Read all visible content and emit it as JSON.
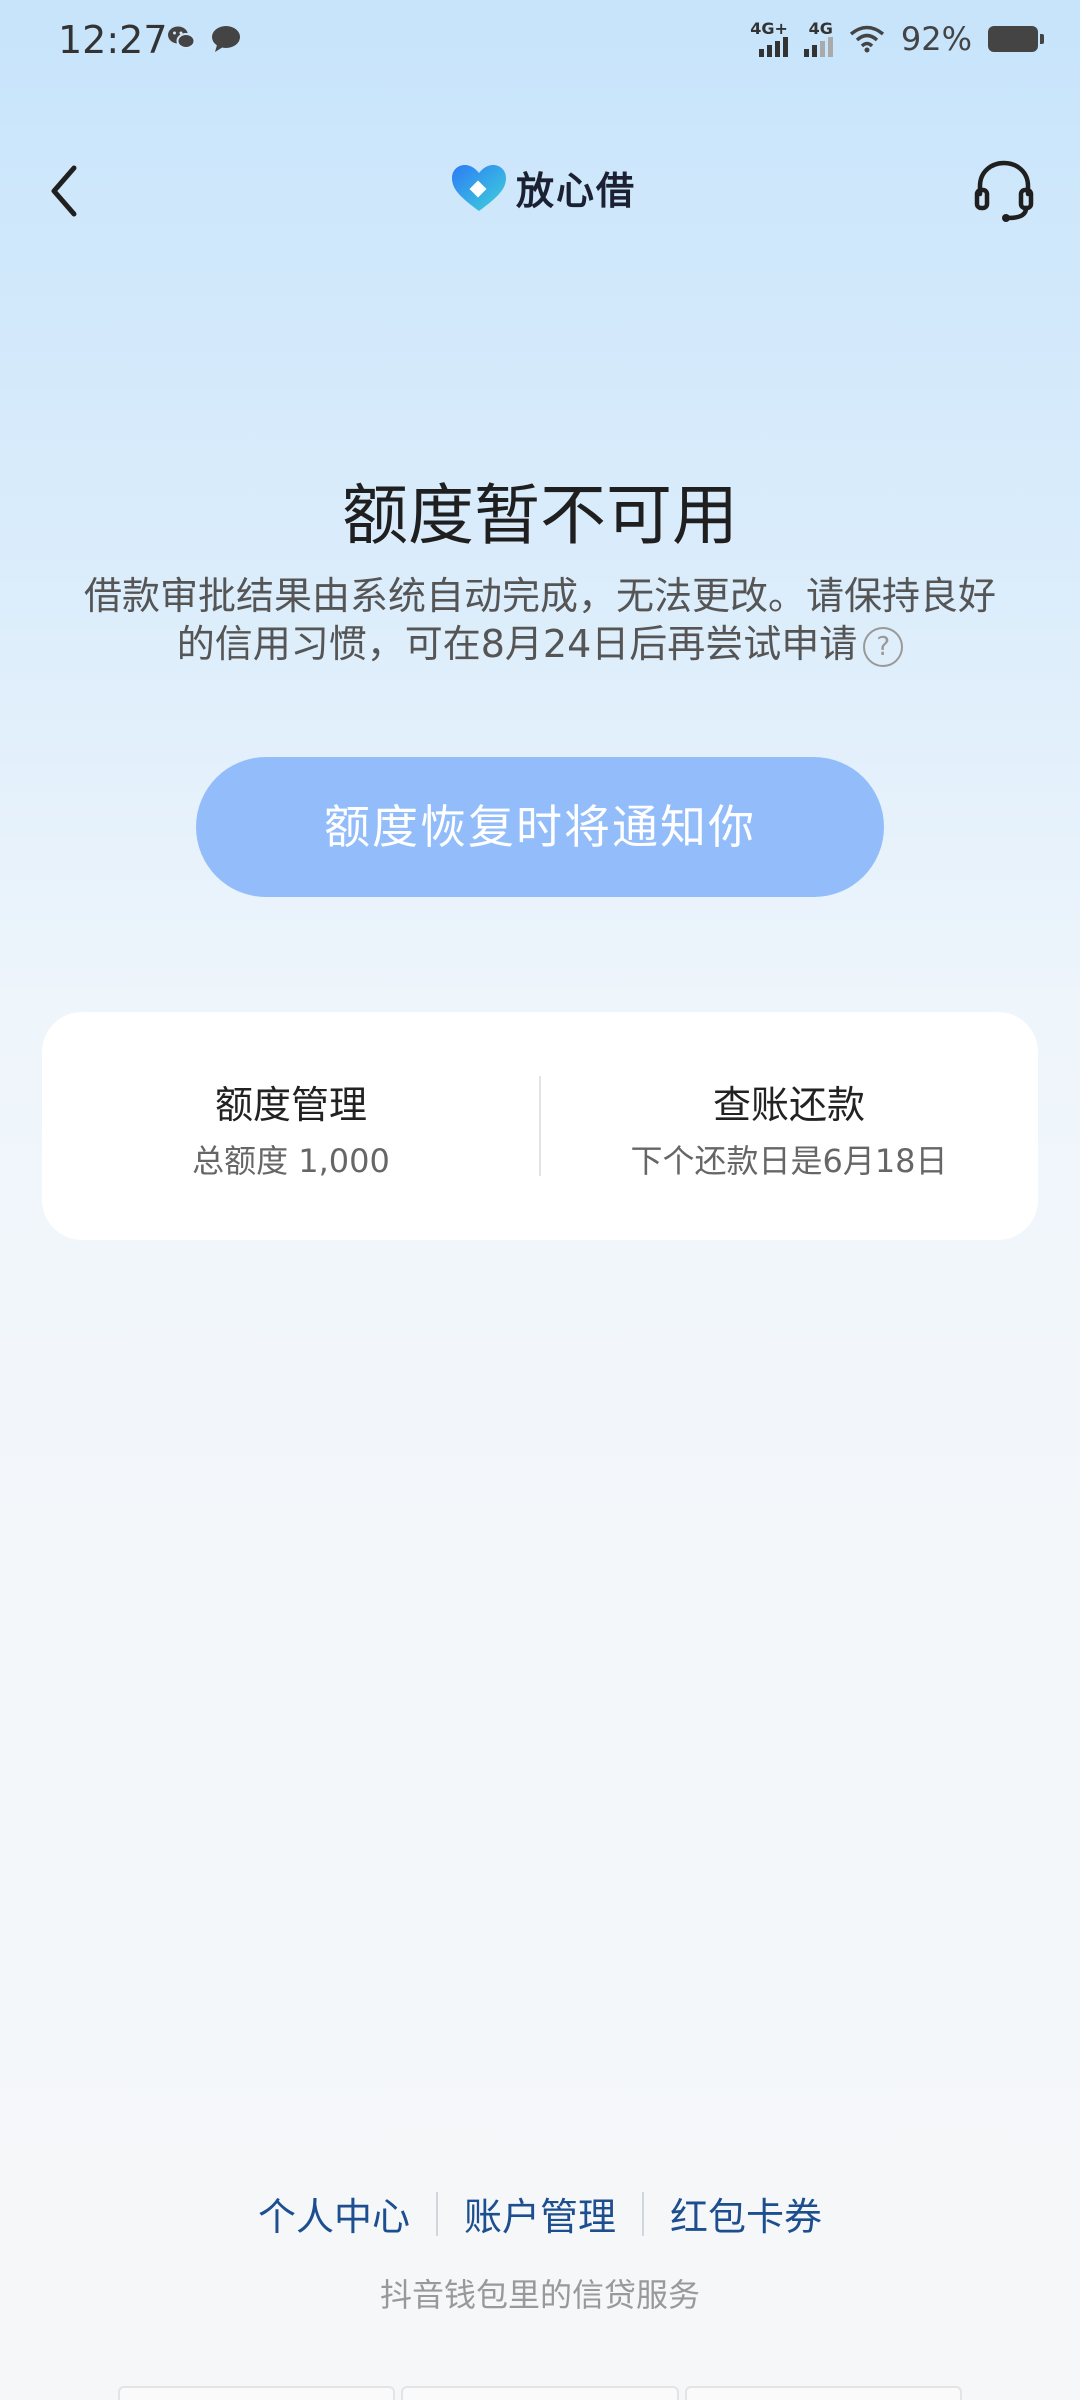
{
  "status_bar": {
    "time": "12:27",
    "network_1": "4G+",
    "network_2": "4G",
    "battery_percent": "92%",
    "icons": [
      "wechat-icon",
      "message-icon",
      "signal-icon",
      "wifi-icon",
      "battery-icon"
    ]
  },
  "header": {
    "brand_name": "放心借",
    "back_icon": "chevron-left-icon",
    "support_icon": "headset-icon"
  },
  "main": {
    "title": "额度暂不可用",
    "description": "借款审批结果由系统自动完成，无法更改。请保持良好的信用习惯，可在8月24日后再尝试申请",
    "help_icon_glyph": "?",
    "notify_button": "额度恢复时将通知你",
    "notify_button_color": "#93bdfa"
  },
  "card": {
    "left": {
      "title": "额度管理",
      "subtitle": "总额度 1,000"
    },
    "right": {
      "title": "查账还款",
      "subtitle": "下个还款日是6月18日"
    }
  },
  "footer": {
    "links": [
      "个人中心",
      "账户管理",
      "红包卡券"
    ],
    "note": "抖音钱包里的信贷服务",
    "link_color": "#1d4e8f"
  }
}
